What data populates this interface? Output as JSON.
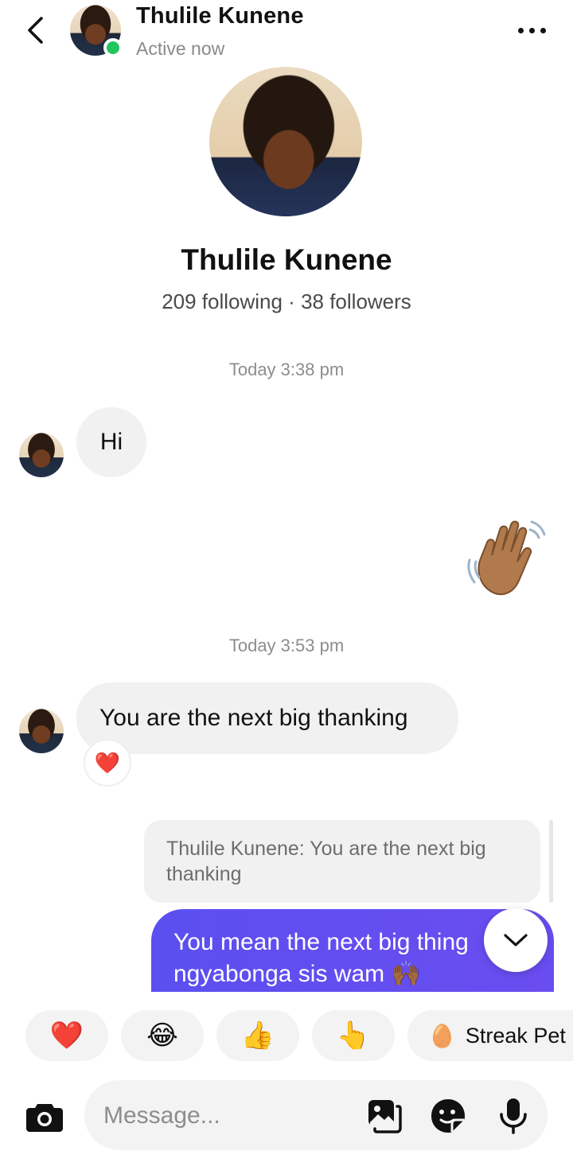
{
  "header": {
    "name": "Thulile Kunene",
    "status": "Active now"
  },
  "profile": {
    "name": "Thulile Kunene",
    "stats": "209 following · 38 followers"
  },
  "messages": {
    "timestamp_1": "Today 3:38 pm",
    "incoming_1": "Hi",
    "outgoing_emoji": "👋🏽",
    "timestamp_2": "Today 3:53 pm",
    "incoming_2": "You are the next big thanking",
    "incoming_2_reaction": "❤️",
    "reply_quote": "Thulile Kunene: You are the next big thanking",
    "outgoing_reply": "You mean the next big thing\nngyabonga sis wam 🙌🏾"
  },
  "quick_reactions": {
    "items": [
      "❤️",
      "😂",
      "👍",
      "👆"
    ],
    "streak_emoji": "🥚",
    "streak_label": "Streak Pet"
  },
  "composer": {
    "placeholder": "Message..."
  },
  "colors": {
    "accent": "#5b4ff0",
    "online": "#22c55e"
  }
}
